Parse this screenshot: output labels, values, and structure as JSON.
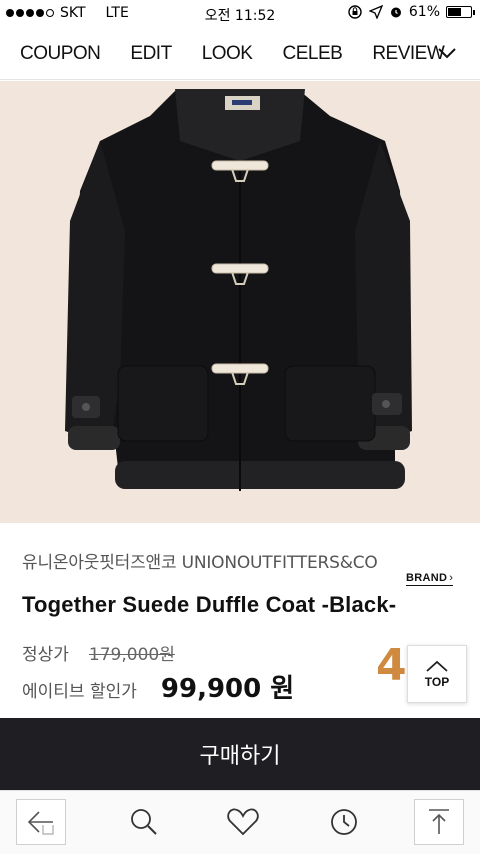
{
  "status_bar": {
    "carrier": "SKT",
    "network": "LTE",
    "time": "오전 11:52",
    "battery": "61%",
    "battery_level": 0.61,
    "signal_bars": 4,
    "signal_total": 5
  },
  "nav": {
    "tabs": [
      "COUPON",
      "EDIT",
      "LOOK",
      "CELEB",
      "REVIEW"
    ]
  },
  "product": {
    "brand": "유니온아웃핏터즈앤코 UNIONOUTFITTERS&CO",
    "brand_link": "BRAND",
    "name": "Together Suede Duffle Coat -Black-",
    "regular_label": "정상가",
    "regular_price": "179,000원",
    "sale_label": "에이티브 할인가",
    "sale_price": "99,900 원"
  },
  "counter": "4",
  "top_button": {
    "label": "TOP"
  },
  "buy_button": {
    "label": "구매하기"
  },
  "bottom_bar": {
    "icons": [
      "back-home-icon",
      "search-icon",
      "heart-icon",
      "clock-icon",
      "share-icon"
    ]
  },
  "colors": {
    "buy_bg": "#1f1f23",
    "accent": "#cf8a3f",
    "hero_bg": "#f1e5dc"
  }
}
